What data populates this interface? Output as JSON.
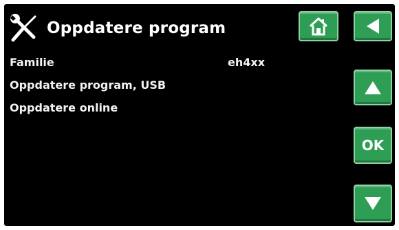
{
  "header": {
    "title": "Oppdatere program",
    "icon": "tools-icon"
  },
  "nav": {
    "home_icon": "home-icon",
    "back_icon": "back-arrow-icon",
    "up_icon": "up-arrow-icon",
    "ok_label": "OK",
    "down_icon": "down-arrow-icon"
  },
  "menu": {
    "items": [
      {
        "label": "Familie",
        "value": "eh4xx"
      },
      {
        "label": "Oppdatere program, USB"
      },
      {
        "label": "Oppdatere online"
      }
    ]
  },
  "colors": {
    "background": "#000000",
    "button": "#2e9e54",
    "button_border": "#8fd3a5",
    "text": "#ffffff"
  }
}
